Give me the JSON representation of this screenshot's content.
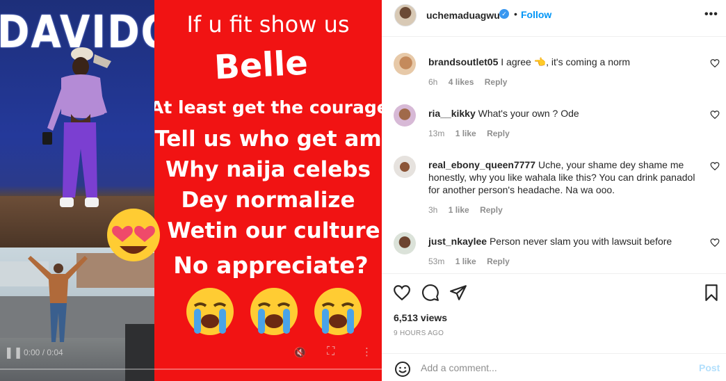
{
  "media": {
    "brand_text": "DAVIDO",
    "lines": [
      "If u fit show us",
      "Belle",
      "At least get the courage",
      "Tell us who get am",
      "Why naija celebs",
      "Dey normalize",
      "Wetin our culture",
      "No appreciate?"
    ],
    "emojis": [
      "crying-face",
      "crying-face",
      "crying-face"
    ],
    "video_time": "0:00 / 0:04",
    "background_color": "#f11313"
  },
  "header": {
    "username": "uchemaduagwu",
    "verified": true,
    "separator": "•",
    "follow_label": "Follow",
    "more_label": "•••"
  },
  "comments": [
    {
      "user": "brandsoutlet05",
      "text": "I agree 👈, it's coming a norm",
      "time": "6h",
      "likes": "4 likes",
      "reply": "Reply"
    },
    {
      "user": "ria__kikky",
      "text": "What's your own ? Ode",
      "time": "13m",
      "likes": "1 like",
      "reply": "Reply"
    },
    {
      "user": "real_ebony_queen7777",
      "text": "Uche, your shame dey shame me honestly, why you like wahala like this? You can drink panadol for another person's headache. Na wa ooo.",
      "time": "3h",
      "likes": "1 like",
      "reply": "Reply"
    },
    {
      "user": "just_nkaylee",
      "text": "Person never slam you with lawsuit before",
      "time": "53m",
      "likes": "1 like",
      "reply": "Reply"
    }
  ],
  "actions": {
    "views": "6,513 views",
    "time_ago": "9 HOURS AGO"
  },
  "add_comment": {
    "placeholder": "Add a comment...",
    "post_label": "Post"
  },
  "colors": {
    "accent": "#0095f6",
    "post_disabled": "#b2dffc",
    "muted": "#8e8e8e"
  }
}
